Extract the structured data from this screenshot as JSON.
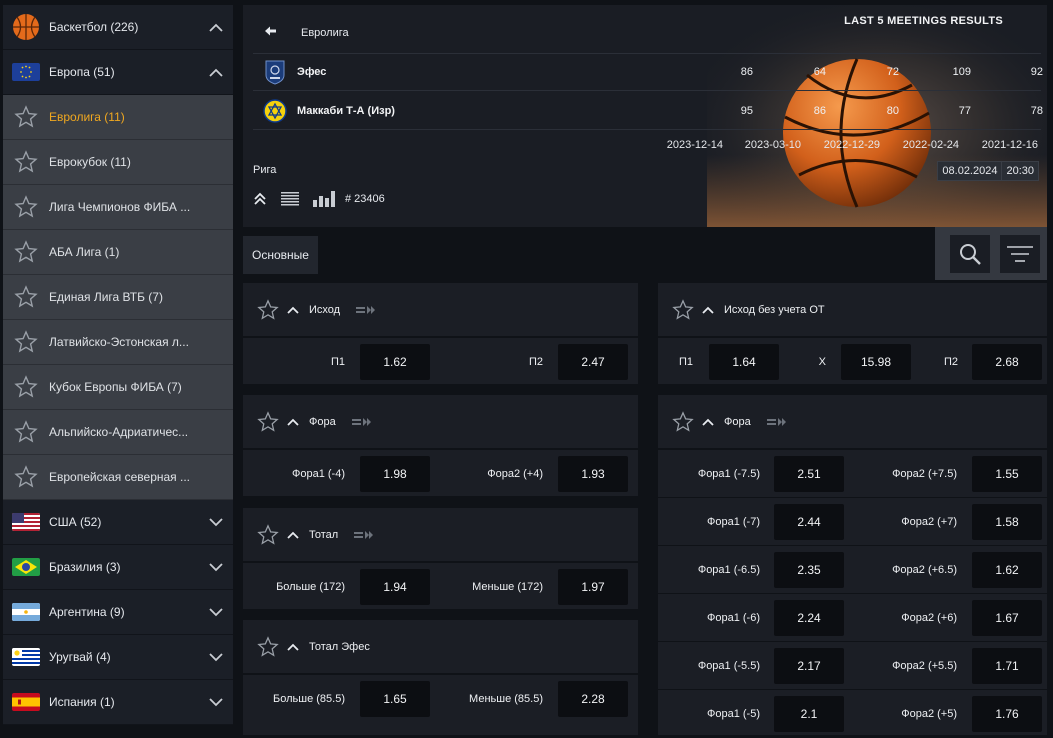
{
  "sidebar": {
    "sport": {
      "label": "Баскетбол (226)",
      "icon": "basketball-icon"
    },
    "region": {
      "label": "Европа (51)",
      "icon": "eu-flag-icon"
    },
    "leagues": [
      {
        "label": "Евролига (11)",
        "active": true
      },
      {
        "label": "Еврокубок (11)"
      },
      {
        "label": "Лига Чемпионов ФИБА ..."
      },
      {
        "label": "АБА Лига (1)"
      },
      {
        "label": "Единая Лига ВТБ (7)"
      },
      {
        "label": "Латвийско-Эстонская л..."
      },
      {
        "label": "Кубок Европы ФИБА (7)"
      },
      {
        "label": "Альпийско-Адриатичес..."
      },
      {
        "label": "Европейская северная ..."
      }
    ],
    "countries": [
      {
        "label": "США (52)",
        "flag": "usa"
      },
      {
        "label": "Бразилия (3)",
        "flag": "brazil"
      },
      {
        "label": "Аргентина (9)",
        "flag": "argentina"
      },
      {
        "label": "Уругвай (4)",
        "flag": "uruguay"
      },
      {
        "label": "Испания (1)",
        "flag": "spain"
      }
    ],
    "active_color": "#f0a820"
  },
  "header": {
    "league": "Евролига",
    "last_meetings_title": "LAST 5 MEETINGS RESULTS",
    "teams": [
      {
        "name": "Эфес",
        "scores": [
          "86",
          "64",
          "72",
          "109",
          "92"
        ]
      },
      {
        "name": "Маккаби Т-А (Изр)",
        "scores": [
          "95",
          "86",
          "80",
          "77",
          "78"
        ]
      }
    ],
    "dates": [
      "2023-12-14",
      "2023-03-10",
      "2022-12-29",
      "2022-02-24",
      "2021-12-16"
    ],
    "city": "Рига",
    "match_date": "08.02.2024",
    "match_time": "20:30",
    "match_number": "# 23406"
  },
  "tabs": {
    "main": "Основные"
  },
  "markets": {
    "ishod": {
      "title": "Исход",
      "selections": [
        {
          "label": "П1",
          "odd": "1.62"
        },
        {
          "label": "П2",
          "odd": "2.47"
        }
      ]
    },
    "ishod_ot": {
      "title": "Исход без учета ОТ",
      "selections": [
        {
          "label": "П1",
          "odd": "1.64"
        },
        {
          "label": "Х",
          "odd": "15.98"
        },
        {
          "label": "П2",
          "odd": "2.68"
        }
      ]
    },
    "fora": {
      "title": "Фора",
      "selections": [
        {
          "label": "Фора1 (-4)",
          "odd": "1.98"
        },
        {
          "label": "Фора2 (+4)",
          "odd": "1.93"
        }
      ]
    },
    "fora_right": {
      "title": "Фора",
      "rows": [
        [
          {
            "label": "Фора1 (-7.5)",
            "odd": "2.51"
          },
          {
            "label": "Фора2 (+7.5)",
            "odd": "1.55"
          }
        ],
        [
          {
            "label": "Фора1 (-7)",
            "odd": "2.44"
          },
          {
            "label": "Фора2 (+7)",
            "odd": "1.58"
          }
        ],
        [
          {
            "label": "Фора1 (-6.5)",
            "odd": "2.35"
          },
          {
            "label": "Фора2 (+6.5)",
            "odd": "1.62"
          }
        ],
        [
          {
            "label": "Фора1 (-6)",
            "odd": "2.24"
          },
          {
            "label": "Фора2 (+6)",
            "odd": "1.67"
          }
        ],
        [
          {
            "label": "Фора1 (-5.5)",
            "odd": "2.17"
          },
          {
            "label": "Фора2 (+5.5)",
            "odd": "1.71"
          }
        ],
        [
          {
            "label": "Фора1 (-5)",
            "odd": "2.1"
          },
          {
            "label": "Фора2 (+5)",
            "odd": "1.76"
          }
        ]
      ]
    },
    "total": {
      "title": "Тотал",
      "selections": [
        {
          "label": "Больше (172)",
          "odd": "1.94"
        },
        {
          "label": "Меньше (172)",
          "odd": "1.97"
        }
      ]
    },
    "total_efes": {
      "title": "Тотал Эфес",
      "selections": [
        {
          "label": "Больше (85.5)",
          "odd": "1.65"
        },
        {
          "label": "Меньше (85.5)",
          "odd": "2.28"
        }
      ]
    }
  }
}
